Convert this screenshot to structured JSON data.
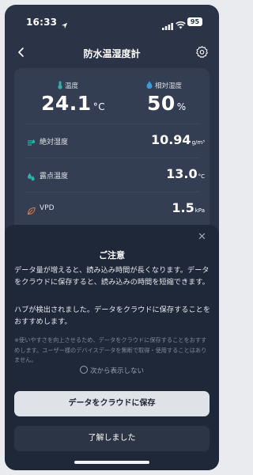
{
  "status_bar": {
    "time": "16:33",
    "battery": "95"
  },
  "nav": {
    "title": "防水温湿度計"
  },
  "readings": {
    "temperature": {
      "label": "温度",
      "value": "24.1",
      "unit": "°C"
    },
    "humidity": {
      "label": "相対湿度",
      "value": "50",
      "unit": "%"
    },
    "rows": [
      {
        "label": "絶対湿度",
        "value": "10.94",
        "unit": "g/m³",
        "icon": "absolute-humidity-icon"
      },
      {
        "label": "露点温度",
        "value": "13.0",
        "unit": "°C",
        "icon": "dew-point-icon"
      },
      {
        "label": "VPD",
        "value": "1.5",
        "unit": "kPa",
        "icon": "leaf-icon"
      }
    ]
  },
  "dialog": {
    "title": "ご注意",
    "p1": "データ量が増えると、読み込み時間が長くなります。データをクラウドに保存すると、読み込みの時間を短縮できます。",
    "p2": "ハブが検出されました。データをクラウドに保存することをおすすめします。",
    "note": "※使いやすさを向上させるため、データをクラウドに保存することをおすすめします。ユーザー様のデバイスデータを無断で取得・使用することはありません。",
    "dont_show": "次から表示しない",
    "primary_button": "データをクラウドに保存",
    "secondary_button": "了解しました"
  },
  "colors": {
    "background": "#2a3446",
    "card": "#343e52",
    "sheet": "#1f2838",
    "temp_icon": "#2bb3a5",
    "humidity_icon": "#3a9bdc",
    "vpd_icon": "#e07a3a"
  }
}
